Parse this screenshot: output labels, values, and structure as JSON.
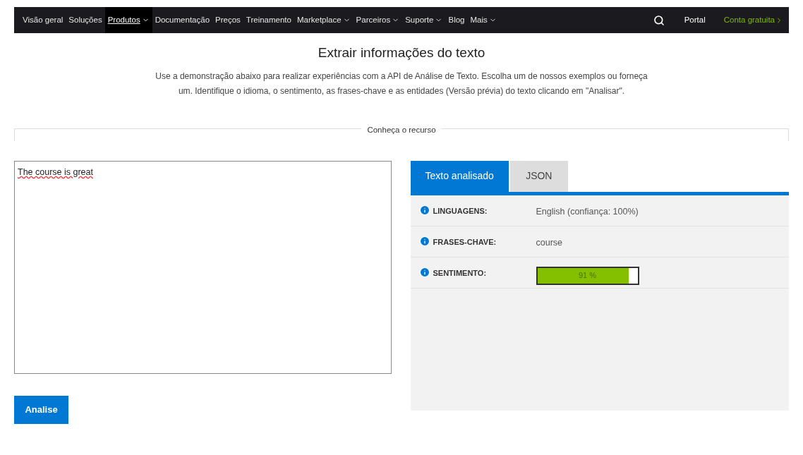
{
  "nav": {
    "items": [
      {
        "label": "Visão geral",
        "selected": false,
        "dropdown": false
      },
      {
        "label": "Soluções",
        "selected": false,
        "dropdown": false
      },
      {
        "label": "Produtos",
        "selected": true,
        "dropdown": true
      },
      {
        "label": "Documentação",
        "selected": false,
        "dropdown": false
      },
      {
        "label": "Preços",
        "selected": false,
        "dropdown": false
      },
      {
        "label": "Treinamento",
        "selected": false,
        "dropdown": false
      },
      {
        "label": "Marketplace",
        "selected": false,
        "dropdown": true
      },
      {
        "label": "Parceiros",
        "selected": false,
        "dropdown": true
      },
      {
        "label": "Suporte",
        "selected": false,
        "dropdown": true
      },
      {
        "label": "Blog",
        "selected": false,
        "dropdown": false
      },
      {
        "label": "Mais",
        "selected": false,
        "dropdown": true
      }
    ],
    "portal": "Portal",
    "free_account": "Conta gratuita"
  },
  "title": "Extrair informações do texto",
  "description": "Use a demonstração abaixo para realizar experiências com a API de Análise de Texto. Escolha um de nossos exemplos ou forneça um. Identifique o idioma, o sentimento, as frases-chave e as entidades (Versão prévia) do texto clicando em \"Analisar\".",
  "section_legend": "Conheça o recurso",
  "input_text": "The course is great",
  "analyze_button": "Analise",
  "tabs": [
    {
      "label": "Texto analisado",
      "selected": true
    },
    {
      "label": "JSON",
      "selected": false
    }
  ],
  "results": [
    {
      "kind": "text",
      "label": "LINGUAGENS:",
      "value": "English (confiança: 100%)"
    },
    {
      "kind": "text",
      "label": "FRASES-CHAVE:",
      "value": "course"
    },
    {
      "kind": "meter",
      "label": "SENTIMENTO:",
      "level": 0.91,
      "reading": "91 %"
    }
  ]
}
